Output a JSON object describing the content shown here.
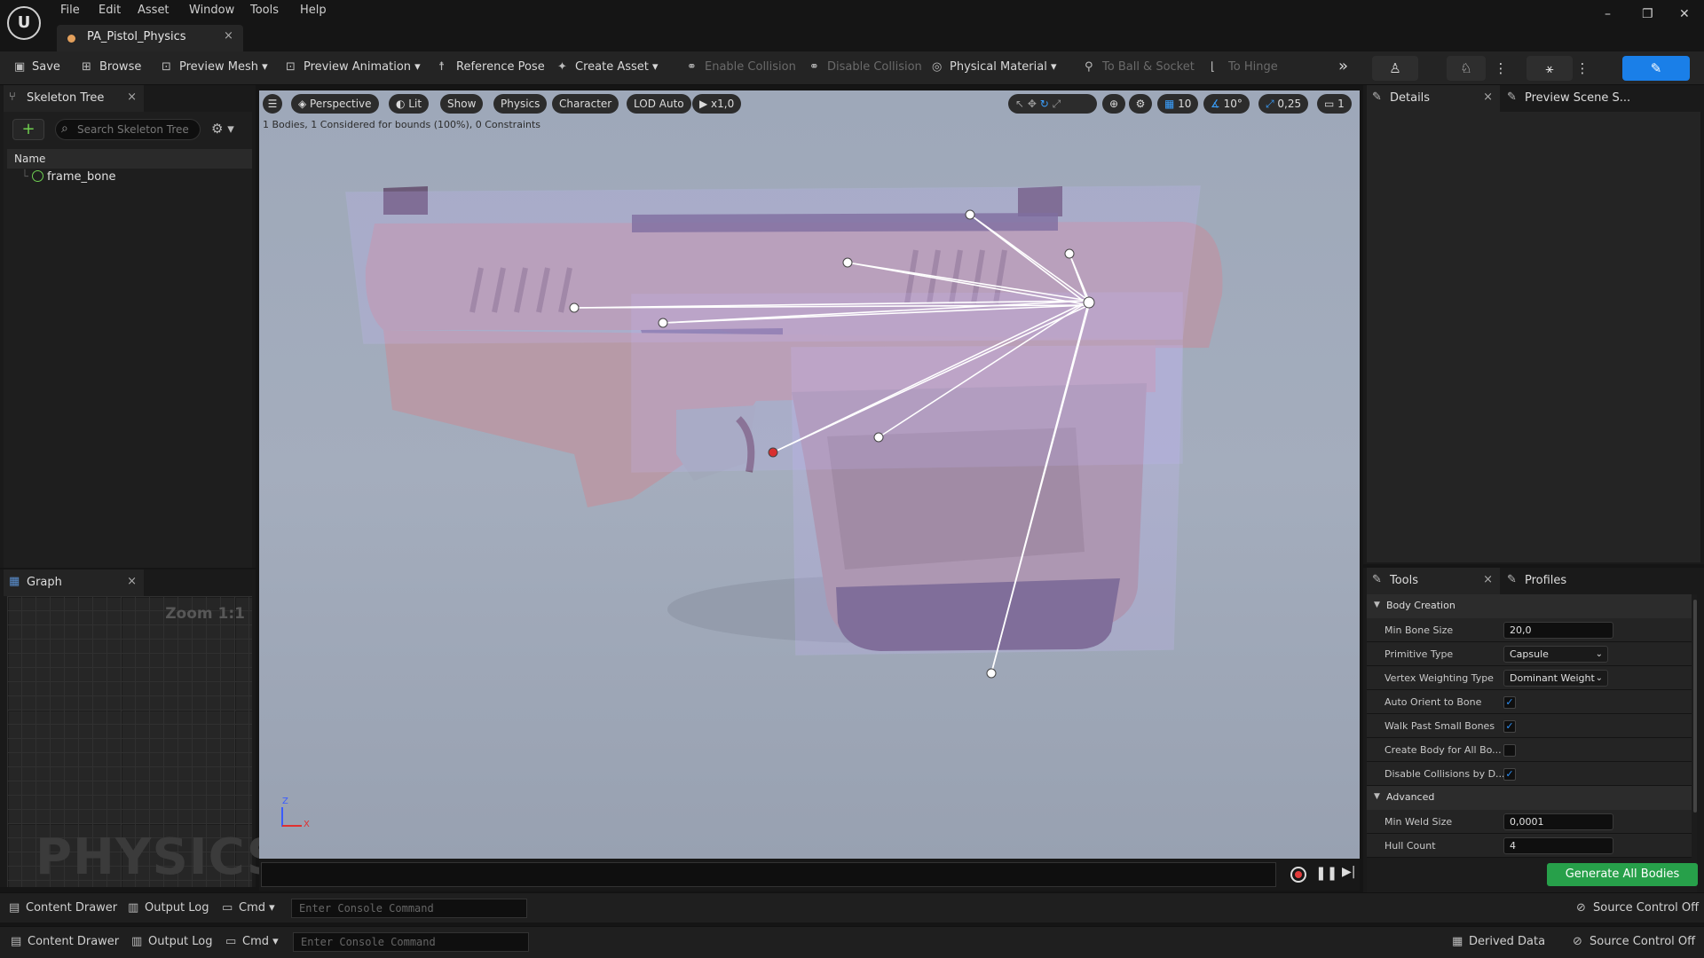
{
  "menu": {
    "logo": "U",
    "items": [
      "File",
      "Edit",
      "Asset",
      "Window",
      "Tools",
      "Help"
    ]
  },
  "document_tab": {
    "title": "PA_Pistol_Physics",
    "close": "×"
  },
  "window_controls": {
    "minimize": "–",
    "restore": "❐",
    "close": "✕"
  },
  "toolbar": {
    "save": "Save",
    "browse": "Browse",
    "preview_mesh": "Preview Mesh",
    "preview_animation": "Preview Animation",
    "reference_pose": "Reference Pose",
    "create_asset": "Create Asset",
    "enable_collision": "Enable Collision",
    "disable_collision": "Disable Collision",
    "physical_material": "Physical Material",
    "to_ball_socket": "To Ball & Socket",
    "to_hinge": "To Hinge",
    "overflow": "»"
  },
  "skeleton_tree": {
    "tab": "Skeleton Tree",
    "add": "+",
    "search_placeholder": "Search Skeleton Tree",
    "column_name": "Name",
    "bone": "frame_bone"
  },
  "graph": {
    "tab": "Graph",
    "zoom": "Zoom 1:1",
    "watermark": "PHYSICS"
  },
  "viewport": {
    "perspective": "Perspective",
    "lit": "Lit",
    "show": "Show",
    "physics": "Physics",
    "character": "Character",
    "lod": "LOD Auto",
    "play_rate": "x1,0",
    "status": "1 Bodies, 1 Considered for bounds (100%), 0 Constraints",
    "grid_snap": "10",
    "rotation_snap": "10°",
    "scale_snap": "0,25",
    "camera_speed": "1",
    "axis_z": "Z",
    "axis_x": "X"
  },
  "details": {
    "tab": "Details",
    "preview_tab": "Preview Scene S..."
  },
  "tools": {
    "tab": "Tools",
    "profiles_tab": "Profiles",
    "section_body_creation": "Body Creation",
    "min_bone_size_label": "Min Bone Size",
    "min_bone_size": "20,0",
    "primitive_type_label": "Primitive Type",
    "primitive_type": "Capsule",
    "vertex_weighting_label": "Vertex Weighting Type",
    "vertex_weighting": "Dominant Weight",
    "auto_orient_label": "Auto Orient to Bone",
    "auto_orient": true,
    "walk_past_label": "Walk Past Small Bones",
    "walk_past": true,
    "create_body_label": "Create Body for All Bo...",
    "create_body": false,
    "disable_collisions_label": "Disable Collisions by D...",
    "disable_collisions": true,
    "section_advanced": "Advanced",
    "min_weld_size_label": "Min Weld Size",
    "min_weld_size": "0,0001",
    "hull_count_label": "Hull Count",
    "hull_count": "4",
    "generate_button": "Generate All Bodies"
  },
  "bottom_bar_1": {
    "content_drawer": "Content Drawer",
    "output_log": "Output Log",
    "cmd": "Cmd",
    "console_placeholder": "Enter Console Command",
    "source_control": "Source Control Off"
  },
  "bottom_bar_2": {
    "content_drawer": "Content Drawer",
    "output_log": "Output Log",
    "cmd": "Cmd",
    "console_placeholder": "Enter Console Command",
    "derived_data": "Derived Data",
    "source_control": "Source Control Off"
  },
  "colors": {
    "accent": "#1a7fe8",
    "generate": "#27a04a",
    "bone": "#6ecf52"
  }
}
